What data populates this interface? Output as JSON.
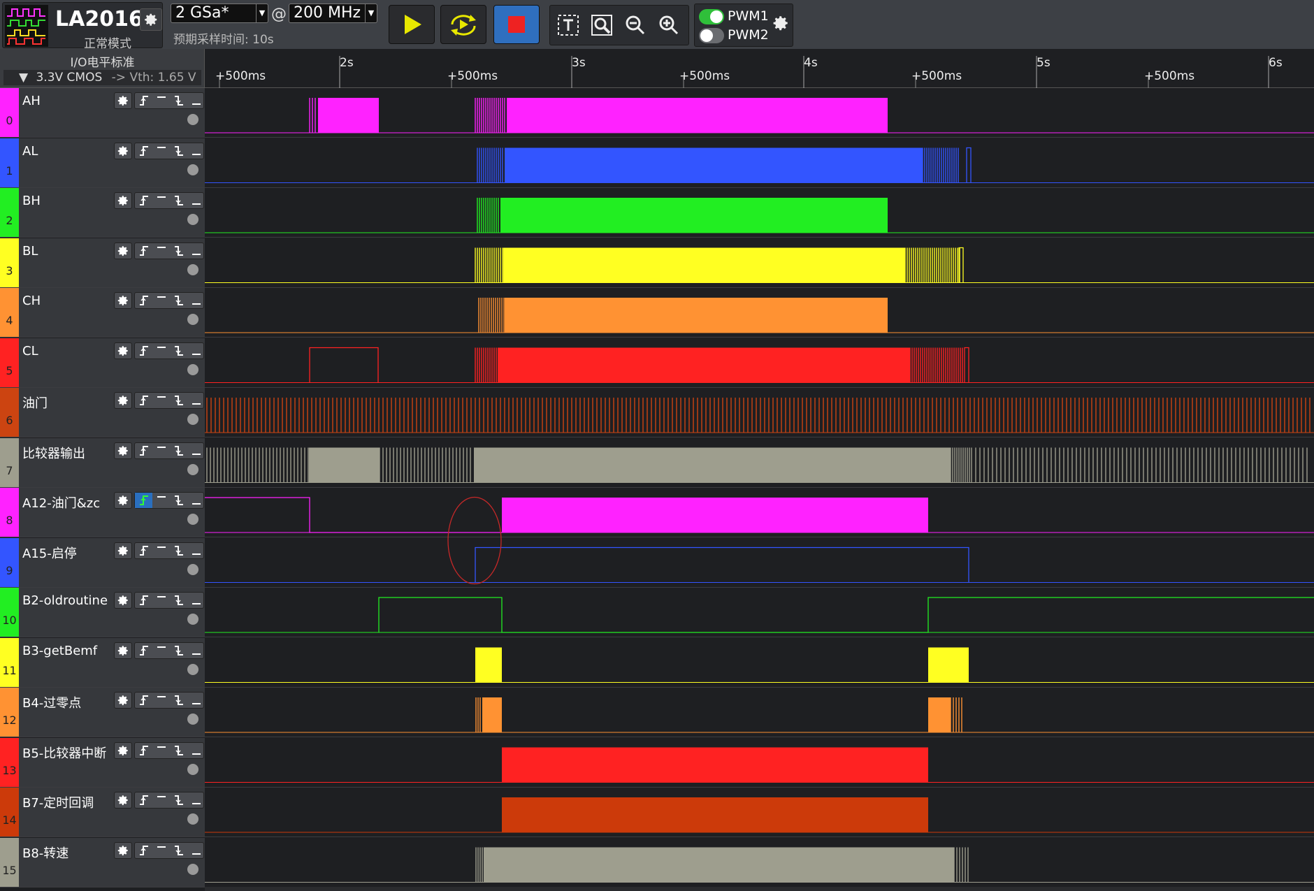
{
  "app": {
    "title": "LA2016",
    "mode": "正常模式"
  },
  "sampling": {
    "rate": "2 GSa*",
    "at": "@",
    "frequency": "200 MHz",
    "time_label": "预期采样时间: 10s"
  },
  "pwm": [
    {
      "label": "PWM1",
      "enabled": true
    },
    {
      "label": "PWM2",
      "enabled": false
    }
  ],
  "io": {
    "title": "I/O电平标准",
    "standard": "3.3V CMOS",
    "vth": "-> Vth: 1.65 V"
  },
  "timeline": {
    "major": [
      "2s",
      "3s",
      "4s",
      "5s",
      "6s"
    ],
    "minor": [
      "+500ms",
      "+500ms",
      "+500ms",
      "+500ms",
      "+500ms",
      "+500ms"
    ]
  },
  "channels": [
    {
      "num": "0",
      "name": "AH",
      "color": "#ff22ff"
    },
    {
      "num": "1",
      "name": "AL",
      "color": "#3355ff"
    },
    {
      "num": "2",
      "name": "BH",
      "color": "#22ee22"
    },
    {
      "num": "3",
      "name": "BL",
      "color": "#ffff22"
    },
    {
      "num": "4",
      "name": "CH",
      "color": "#ff9233"
    },
    {
      "num": "5",
      "name": "CL",
      "color": "#ff2222"
    },
    {
      "num": "6",
      "name": "油门",
      "color": "#cc4411"
    },
    {
      "num": "7",
      "name": "比较器输出",
      "color": "#9e9e8e"
    },
    {
      "num": "8",
      "name": "A12-油门&zc",
      "color": "#ff22ff"
    },
    {
      "num": "9",
      "name": "A15-启停",
      "color": "#3355ff"
    },
    {
      "num": "10",
      "name": "B2-oldroutine",
      "color": "#22ee22"
    },
    {
      "num": "11",
      "name": "B3-getBemf",
      "color": "#ffff22"
    },
    {
      "num": "12",
      "name": "B4-过零点",
      "color": "#ff9233"
    },
    {
      "num": "13",
      "name": "B5-比较器中断",
      "color": "#ff2222"
    },
    {
      "num": "14",
      "name": "B7-定时回调",
      "color": "#cc3a0a"
    },
    {
      "num": "15",
      "name": "B8-转速",
      "color": "#9e9e8e"
    }
  ]
}
